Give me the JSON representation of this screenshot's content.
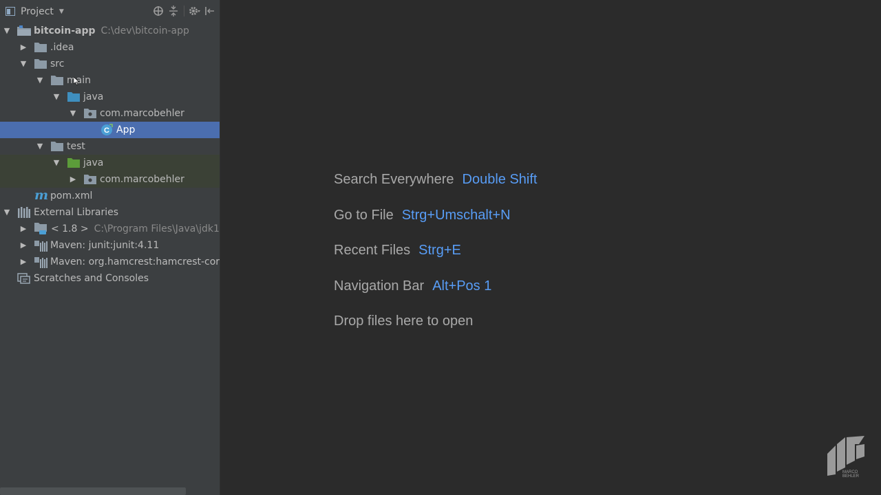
{
  "toolbar": {
    "title": "Project",
    "icons": [
      "locate-icon",
      "collapse-icon",
      "gear-icon",
      "hide-icon"
    ]
  },
  "tree": {
    "root": {
      "name": "bitcoin-app",
      "path": "C:\\dev\\bitcoin-app"
    },
    "idea": ".idea",
    "src": "src",
    "main": "main",
    "main_java": "java",
    "main_pkg": "com.marcobehler",
    "app": "App",
    "test": "test",
    "test_java": "java",
    "test_pkg": "com.marcobehler",
    "pom": "pom.xml",
    "external_libraries": "External Libraries",
    "jdk": {
      "name": "< 1.8 >",
      "path": "C:\\Program Files\\Java\\jdk1"
    },
    "junit": "Maven: junit:junit:4.11",
    "hamcrest": "Maven: org.hamcrest:hamcrest-cor",
    "scratches": "Scratches and Consoles"
  },
  "welcome": {
    "search_label": "Search Everywhere",
    "search_key": "Double Shift",
    "goto_label": "Go to File",
    "goto_key": "Strg+Umschalt+N",
    "recent_label": "Recent Files",
    "recent_key": "Strg+E",
    "nav_label": "Navigation Bar",
    "nav_key": "Alt+Pos 1",
    "drop_label": "Drop files here to open"
  },
  "colors": {
    "editor_bg": "#2b2b2b",
    "sidebar_bg": "#3c3f41",
    "selection": "#4b6eaf",
    "shortcut": "#589df6",
    "source_folder": "#3f8fbf",
    "test_folder": "#5c9c3a"
  }
}
